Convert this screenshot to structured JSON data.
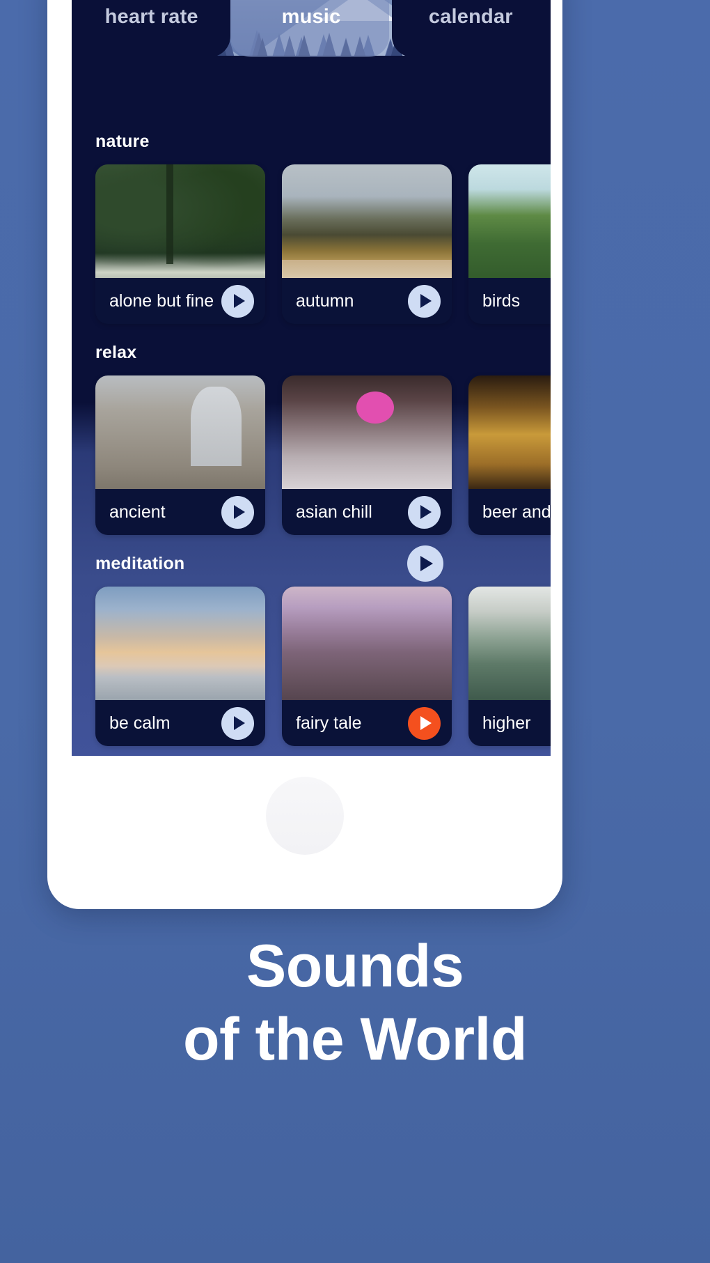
{
  "app": {
    "tabs": [
      {
        "label": "heart rate",
        "active": false
      },
      {
        "label": "music",
        "active": true
      },
      {
        "label": "calendar",
        "active": false
      }
    ],
    "sections": [
      {
        "title": "nature",
        "has_header_play": false,
        "cards": [
          {
            "label": "alone but fine",
            "play_style": "default",
            "image": "forest-redwoods"
          },
          {
            "label": "autumn",
            "play_style": "default",
            "image": "autumn-larch-forest"
          },
          {
            "label": "birds",
            "play_style": "default",
            "image": "green-hillside-trees"
          }
        ]
      },
      {
        "title": "relax",
        "has_header_play": false,
        "cards": [
          {
            "label": "ancient",
            "play_style": "default",
            "image": "stone-abbey-ruins"
          },
          {
            "label": "asian chill",
            "play_style": "default",
            "image": "asian-street-pink-lantern"
          },
          {
            "label": "beer and",
            "play_style": "default",
            "image": "warm-lit-bar-interior"
          }
        ]
      },
      {
        "title": "meditation",
        "has_header_play": true,
        "cards": [
          {
            "label": "be calm",
            "play_style": "default",
            "image": "sunset-ocean-horizon"
          },
          {
            "label": "fairy tale",
            "play_style": "accent",
            "image": "pink-cliff-village"
          },
          {
            "label": "higher",
            "play_style": "default",
            "image": "misty-green-mountains"
          }
        ]
      }
    ]
  },
  "caption": {
    "line1": "Sounds",
    "line2": "of the World"
  },
  "colors": {
    "background": "#4a6aaa",
    "screen": "#0a1038",
    "card": "#0a1238",
    "play": "#cfdcf4",
    "play_accent": "#f4501e",
    "text": "#ffffff",
    "tab_inactive": "#c4cade"
  },
  "icons": {
    "play": "play-icon",
    "home_button": "home-button-icon"
  }
}
